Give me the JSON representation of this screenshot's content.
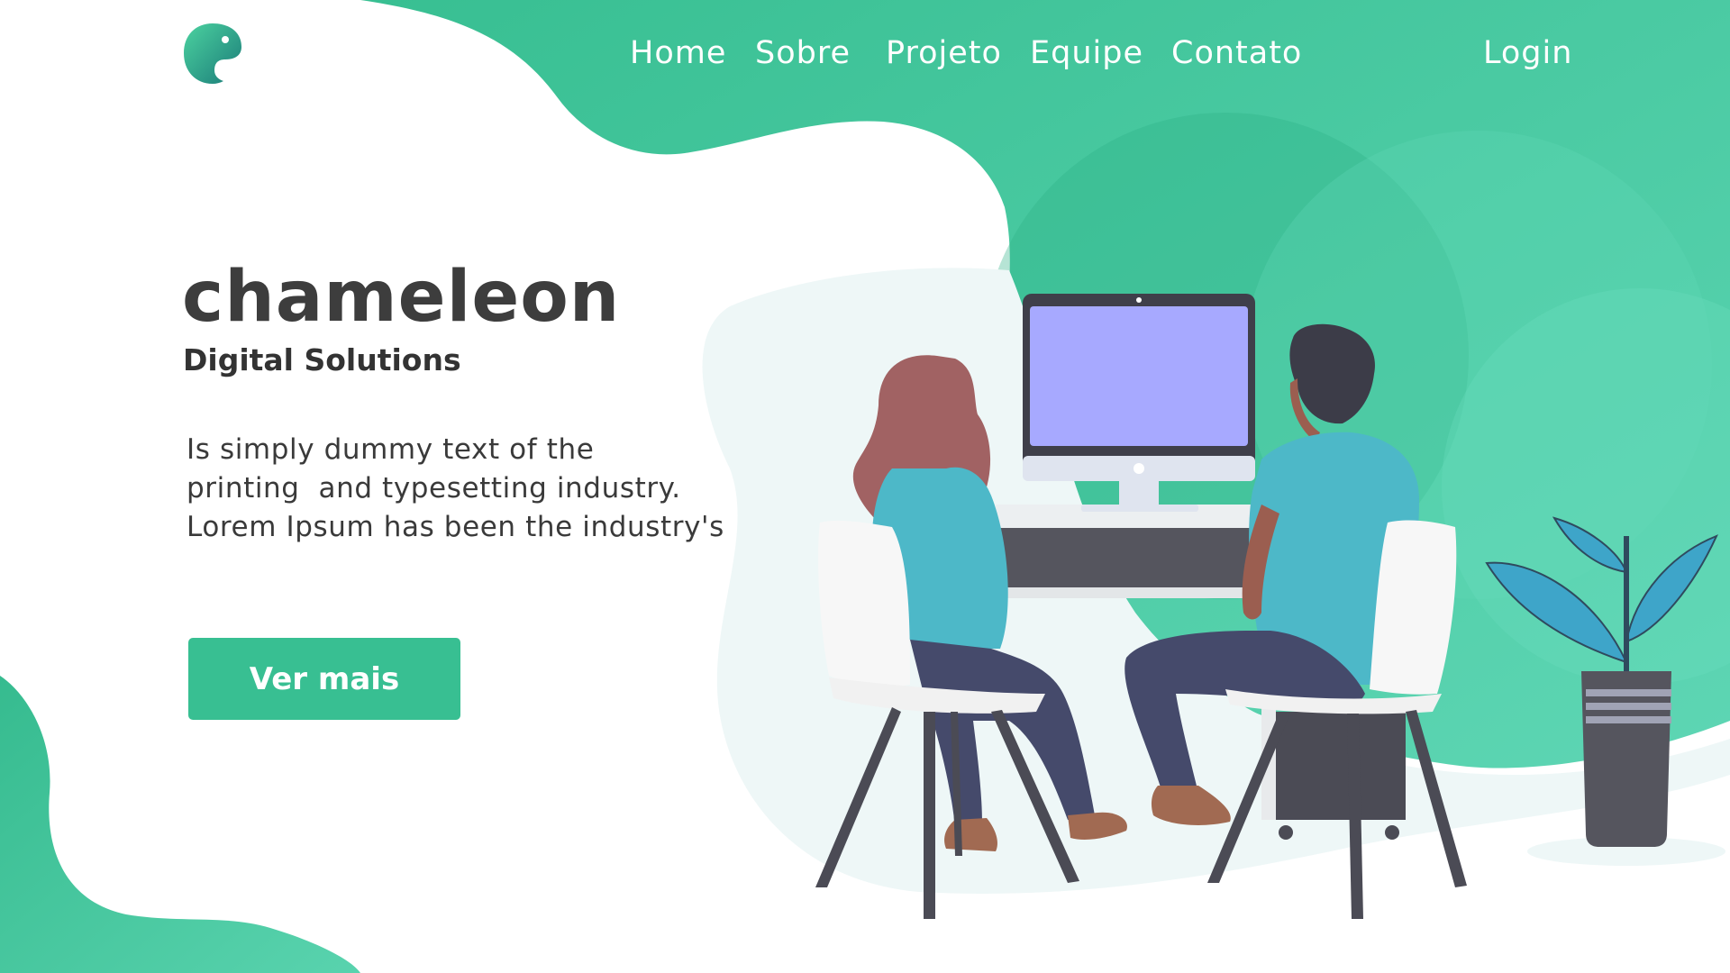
{
  "brand": {
    "logo_icon": "chameleon-logo-icon",
    "accent_color": "#38bf92"
  },
  "nav": {
    "items": [
      {
        "label": "Home"
      },
      {
        "label": "Sobre"
      },
      {
        "label": "Projeto"
      },
      {
        "label": "Equipe"
      },
      {
        "label": "Contato"
      }
    ],
    "login_label": "Login"
  },
  "hero": {
    "title": "chameleon",
    "subtitle": "Digital Solutions",
    "description_lines": [
      "Is simply dummy text of the",
      "printing  and typesetting industry.",
      "Lorem Ipsum has been the industry's"
    ],
    "cta_label": "Ver mais"
  },
  "illustration": {
    "name": "two-people-working-at-computer-illustration"
  }
}
